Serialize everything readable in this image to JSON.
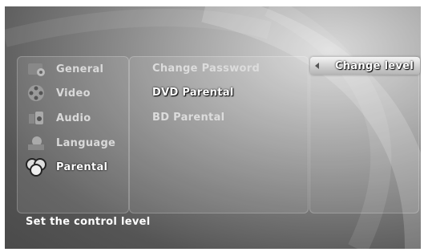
{
  "categories": [
    {
      "label": "General",
      "icon": "wrench-gear-icon"
    },
    {
      "label": "Video",
      "icon": "film-reel-icon"
    },
    {
      "label": "Audio",
      "icon": "speaker-icon"
    },
    {
      "label": "Language",
      "icon": "globe-books-icon"
    },
    {
      "label": "Parental",
      "icon": "family-icon",
      "active": true
    }
  ],
  "options": [
    {
      "label": "Change Password"
    },
    {
      "label": "DVD Parental",
      "highlight": true
    },
    {
      "label": "BD Parental"
    }
  ],
  "value": {
    "label": "Change level"
  },
  "status": "Set the control level",
  "colors": {
    "accent": "#ffffff",
    "panel_text": "#dcdcdc",
    "background": "#7a7a7a"
  }
}
